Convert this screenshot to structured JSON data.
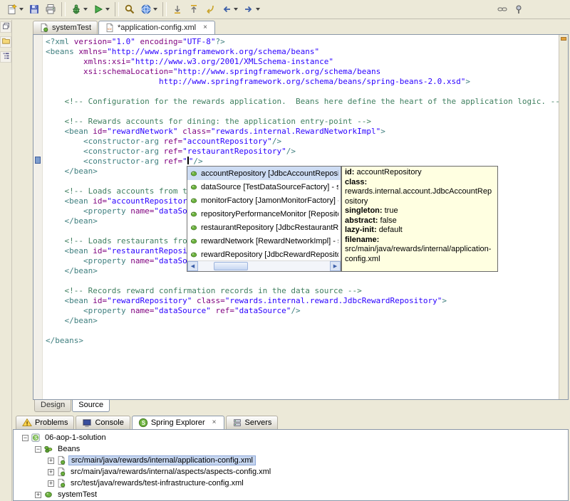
{
  "colors": {
    "chrome": "#ece9d8",
    "tooltip_bg": "#ffffe1",
    "tree_selection": "#c6d6f0",
    "syntax_tag": "#3f7f7f",
    "syntax_attribute": "#7f007f",
    "syntax_value": "#2a00ff",
    "syntax_comment": "#3f7f5f"
  },
  "toolbar": {
    "items": [
      {
        "name": "new-wizard-button",
        "icon": "new",
        "dropdown": true
      },
      {
        "name": "save-button",
        "icon": "save"
      },
      {
        "name": "print-button",
        "icon": "print"
      },
      {
        "separator": true
      },
      {
        "name": "debug-button",
        "icon": "debug",
        "dropdown": true
      },
      {
        "name": "run-button",
        "icon": "run",
        "dropdown": true
      },
      {
        "separator": true
      },
      {
        "name": "search-button",
        "icon": "search"
      },
      {
        "name": "open-web-browser-button",
        "icon": "globe",
        "dropdown": true
      },
      {
        "separator": true
      },
      {
        "name": "next-annotation-button",
        "icon": "next"
      },
      {
        "name": "previous-annotation-button",
        "icon": "prev"
      },
      {
        "name": "last-edit-location-button",
        "icon": "lastedit"
      },
      {
        "name": "back-button",
        "icon": "back",
        "dropdown": true
      },
      {
        "name": "forward-button",
        "icon": "forward",
        "dropdown": true
      }
    ],
    "right_items": [
      {
        "name": "link-with-editor-button",
        "icon": "link"
      },
      {
        "name": "pin-editor-button",
        "icon": "pin"
      }
    ]
  },
  "left_bar": {
    "items": [
      {
        "name": "restore-views-button",
        "icon": "restore"
      },
      {
        "name": "package-explorer-shortcut-button",
        "icon": "pkg"
      },
      {
        "name": "outline-shortcut-button",
        "icon": "outline"
      }
    ]
  },
  "editor_tabs": [
    {
      "label": "systemTest",
      "active": false
    },
    {
      "label": "*application-config.xml",
      "active": true
    }
  ],
  "editor": {
    "design_label": "Design",
    "source_label": "Source",
    "lines": [
      [
        [
          "t",
          "<?xml "
        ],
        [
          "a",
          "version="
        ],
        [
          "v",
          "\"1.0\""
        ],
        [
          "p",
          " "
        ],
        [
          "a",
          "encoding="
        ],
        [
          "v",
          "\"UTF-8\""
        ],
        [
          "t",
          "?>"
        ]
      ],
      [
        [
          "t",
          "<beans "
        ],
        [
          "a",
          "xmlns="
        ],
        [
          "v",
          "\"http://www.springframework.org/schema/beans\""
        ]
      ],
      [
        [
          "p",
          "        "
        ],
        [
          "a",
          "xmlns:xsi="
        ],
        [
          "v",
          "\"http://www.w3.org/2001/XMLSchema-instance\""
        ]
      ],
      [
        [
          "p",
          "        "
        ],
        [
          "a",
          "xsi:schemaLocation="
        ],
        [
          "v",
          "\"http://www.springframework.org/schema/beans"
        ]
      ],
      [
        [
          "p",
          "                        "
        ],
        [
          "v",
          "http://www.springframework.org/schema/beans/spring-beans-2.0.xsd\""
        ],
        [
          "t",
          ">"
        ]
      ],
      [],
      [
        [
          "p",
          "    "
        ],
        [
          "c",
          "<!-- Configuration for the rewards application.  Beans here define the heart of the application logic. -->"
        ]
      ],
      [],
      [
        [
          "p",
          "    "
        ],
        [
          "c",
          "<!-- Rewards accounts for dining: the application entry-point -->"
        ]
      ],
      [
        [
          "p",
          "    "
        ],
        [
          "t",
          "<bean "
        ],
        [
          "a",
          "id="
        ],
        [
          "v",
          "\"rewardNetwork\""
        ],
        [
          "p",
          " "
        ],
        [
          "a",
          "class="
        ],
        [
          "v",
          "\"rewards.internal.RewardNetworkImpl\""
        ],
        [
          "t",
          ">"
        ]
      ],
      [
        [
          "p",
          "        "
        ],
        [
          "t",
          "<constructor-arg "
        ],
        [
          "a",
          "ref="
        ],
        [
          "v",
          "\"accountRepository\""
        ],
        [
          "t",
          "/>"
        ]
      ],
      [
        [
          "p",
          "        "
        ],
        [
          "t",
          "<constructor-arg "
        ],
        [
          "a",
          "ref="
        ],
        [
          "v",
          "\"restaurantRepository\""
        ],
        [
          "t",
          "/>"
        ]
      ],
      [
        [
          "p",
          "        "
        ],
        [
          "t",
          "<constructor-arg "
        ],
        [
          "a",
          "ref="
        ],
        [
          "v",
          "\""
        ],
        [
          "k",
          ""
        ],
        [
          "v",
          "\""
        ],
        [
          "t",
          "/>"
        ]
      ],
      [
        [
          "p",
          "    "
        ],
        [
          "t",
          "</bean>"
        ]
      ],
      [],
      [
        [
          "p",
          "    "
        ],
        [
          "c",
          "<!-- Loads accounts from t"
        ]
      ],
      [
        [
          "p",
          "    "
        ],
        [
          "t",
          "<bean "
        ],
        [
          "a",
          "id="
        ],
        [
          "v",
          "\"accountRepositor"
        ]
      ],
      [
        [
          "p",
          "        "
        ],
        [
          "t",
          "<property "
        ],
        [
          "a",
          "name="
        ],
        [
          "v",
          "\"dataSo"
        ]
      ],
      [
        [
          "p",
          "    "
        ],
        [
          "t",
          "</bean>"
        ]
      ],
      [],
      [
        [
          "p",
          "    "
        ],
        [
          "c",
          "<!-- Loads restaurants fro"
        ]
      ],
      [
        [
          "p",
          "    "
        ],
        [
          "t",
          "<bean "
        ],
        [
          "a",
          "id="
        ],
        [
          "v",
          "\"restaurantReposi"
        ]
      ],
      [
        [
          "p",
          "        "
        ],
        [
          "t",
          "<property "
        ],
        [
          "a",
          "name="
        ],
        [
          "v",
          "\"dataSo"
        ]
      ],
      [
        [
          "p",
          "    "
        ],
        [
          "t",
          "</bean>"
        ]
      ],
      [],
      [
        [
          "p",
          "    "
        ],
        [
          "c",
          "<!-- Records reward confirmation records in the data source -->"
        ]
      ],
      [
        [
          "p",
          "    "
        ],
        [
          "t",
          "<bean "
        ],
        [
          "a",
          "id="
        ],
        [
          "v",
          "\"rewardRepository\""
        ],
        [
          "p",
          " "
        ],
        [
          "a",
          "class="
        ],
        [
          "v",
          "\"rewards.internal.reward.JdbcRewardRepository\""
        ],
        [
          "t",
          ">"
        ]
      ],
      [
        [
          "p",
          "        "
        ],
        [
          "t",
          "<property "
        ],
        [
          "a",
          "name="
        ],
        [
          "v",
          "\"dataSource\""
        ],
        [
          "p",
          " "
        ],
        [
          "a",
          "ref="
        ],
        [
          "v",
          "\"dataSource\""
        ],
        [
          "t",
          "/>"
        ]
      ],
      [
        [
          "p",
          "    "
        ],
        [
          "t",
          "</bean>"
        ]
      ],
      [],
      [
        [
          "t",
          "</beans>"
        ]
      ]
    ]
  },
  "content_assist": {
    "items": [
      {
        "label": "accountRepository [JdbcAccountRepository] - src/ja",
        "selected": true
      },
      {
        "label": "dataSource [TestDataSourceFactory] - src/test/ja",
        "selected": false
      },
      {
        "label": "monitorFactory [JamonMonitorFactory] - src/main",
        "selected": false
      },
      {
        "label": "repositoryPerformanceMonitor [RepositoryPerfor",
        "selected": false
      },
      {
        "label": "restaurantRepository [JdbcRestaurantRepository",
        "selected": false
      },
      {
        "label": "rewardNetwork [RewardNetworkImpl] - src/main/j",
        "selected": false
      },
      {
        "label": "rewardRepository [JdbcRewardRepository] - src/r",
        "selected": false
      }
    ]
  },
  "bean_tooltip": {
    "fields": [
      {
        "label": "id:",
        "value": "accountRepository"
      },
      {
        "label": "class:",
        "value": "rewards.internal.account.JdbcAccountRepository"
      },
      {
        "label": "singleton:",
        "value": "true"
      },
      {
        "label": "abstract:",
        "value": "false"
      },
      {
        "label": "lazy-init:",
        "value": "default"
      },
      {
        "label": "filename:",
        "value": "src/main/java/rewards/internal/application-config.xml"
      }
    ]
  },
  "bottom_panel": {
    "tabs": [
      {
        "label": "Problems",
        "icon": "problems",
        "active": false
      },
      {
        "label": "Console",
        "icon": "console",
        "active": false
      },
      {
        "label": "Spring Explorer",
        "icon": "spring",
        "active": true,
        "closable": true
      },
      {
        "label": "Servers",
        "icon": "servers",
        "active": false
      }
    ],
    "tree": [
      {
        "level": 0,
        "expanded": true,
        "icon": "springproj",
        "label": "06-aop-1-solution",
        "selected": false
      },
      {
        "level": 1,
        "expanded": true,
        "icon": "beans",
        "label": "Beans",
        "selected": false
      },
      {
        "level": 2,
        "expanded": false,
        "icon": "configfile",
        "label": "src/main/java/rewards/internal/application-config.xml",
        "selected": true
      },
      {
        "level": 2,
        "expanded": false,
        "icon": "configfile",
        "label": "src/main/java/rewards/internal/aspects/aspects-config.xml",
        "selected": false
      },
      {
        "level": 2,
        "expanded": false,
        "icon": "configfile",
        "label": "src/test/java/rewards/test-infrastructure-config.xml",
        "selected": false
      },
      {
        "level": 1,
        "expanded": false,
        "icon": "bean",
        "label": "systemTest",
        "selected": false
      }
    ]
  }
}
